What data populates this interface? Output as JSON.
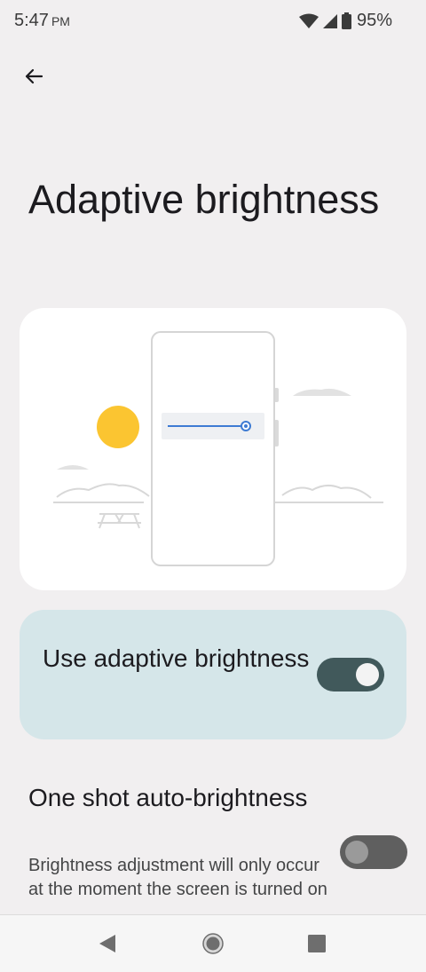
{
  "status_bar": {
    "time": "5:47",
    "ampm": "PM",
    "battery": "95%",
    "icons": [
      "wifi-icon",
      "signal-icon",
      "battery-icon"
    ]
  },
  "header": {
    "back_icon": "arrow-back-icon",
    "title": "Adaptive brightness"
  },
  "illustration": {
    "sun_color": "#fbc531",
    "slider_color": "#3e7bd3"
  },
  "main_toggle": {
    "label": "Use adaptive brightness",
    "checked": true,
    "track_color": "#41595b",
    "card_color": "#d5e6e9"
  },
  "one_shot": {
    "title": "One shot auto-brightness",
    "summary": "Brightness adjustment will only occur at the moment the screen is turned on",
    "checked": false
  },
  "nav_bar": {
    "icons": [
      "nav-back-icon",
      "nav-home-icon",
      "nav-recents-icon"
    ]
  }
}
